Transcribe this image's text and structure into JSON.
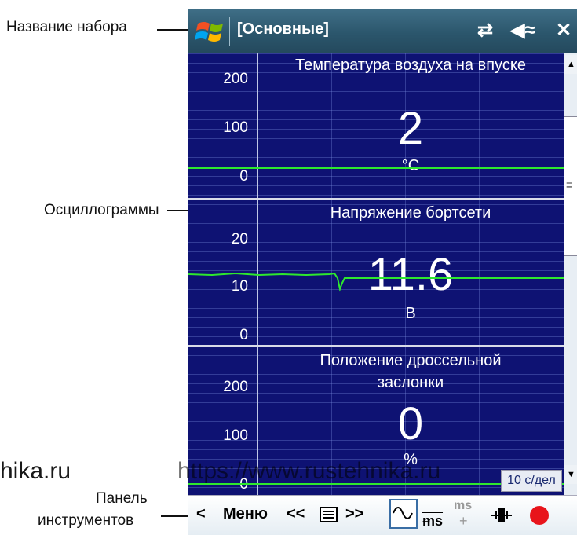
{
  "annotations": {
    "set_name": "Название набора",
    "waveforms": "Осциллограммы",
    "toolbar_line1": "Панель",
    "toolbar_line2": "инструментов"
  },
  "window": {
    "title": "[Основные]"
  },
  "panels": [
    {
      "title": "Температура воздуха на впуске",
      "value": "2",
      "unit": "°C",
      "y_ticks": [
        "200",
        "100",
        "0"
      ]
    },
    {
      "title": "Напряжение бортсети",
      "value": "11.6",
      "unit": "В",
      "y_ticks": [
        "20",
        "10",
        "0"
      ]
    },
    {
      "title_line1": "Положение дроссельной",
      "title_line2": "заслонки",
      "value": "0",
      "unit": "%",
      "y_ticks": [
        "200",
        "100",
        "0"
      ]
    }
  ],
  "time_scale": "10 с/дел",
  "toolbar": {
    "back": "<",
    "menu": "Меню",
    "prev": "<<",
    "next": ">>",
    "ms_top": "ms",
    "ms_plus": "+"
  },
  "watermark": {
    "left": "hika.ru",
    "right": "https://www.rustehnika.ru"
  },
  "colors": {
    "trace": "#2ee82e",
    "scope_bg": "#0e1273",
    "record": "#e8141b"
  }
}
